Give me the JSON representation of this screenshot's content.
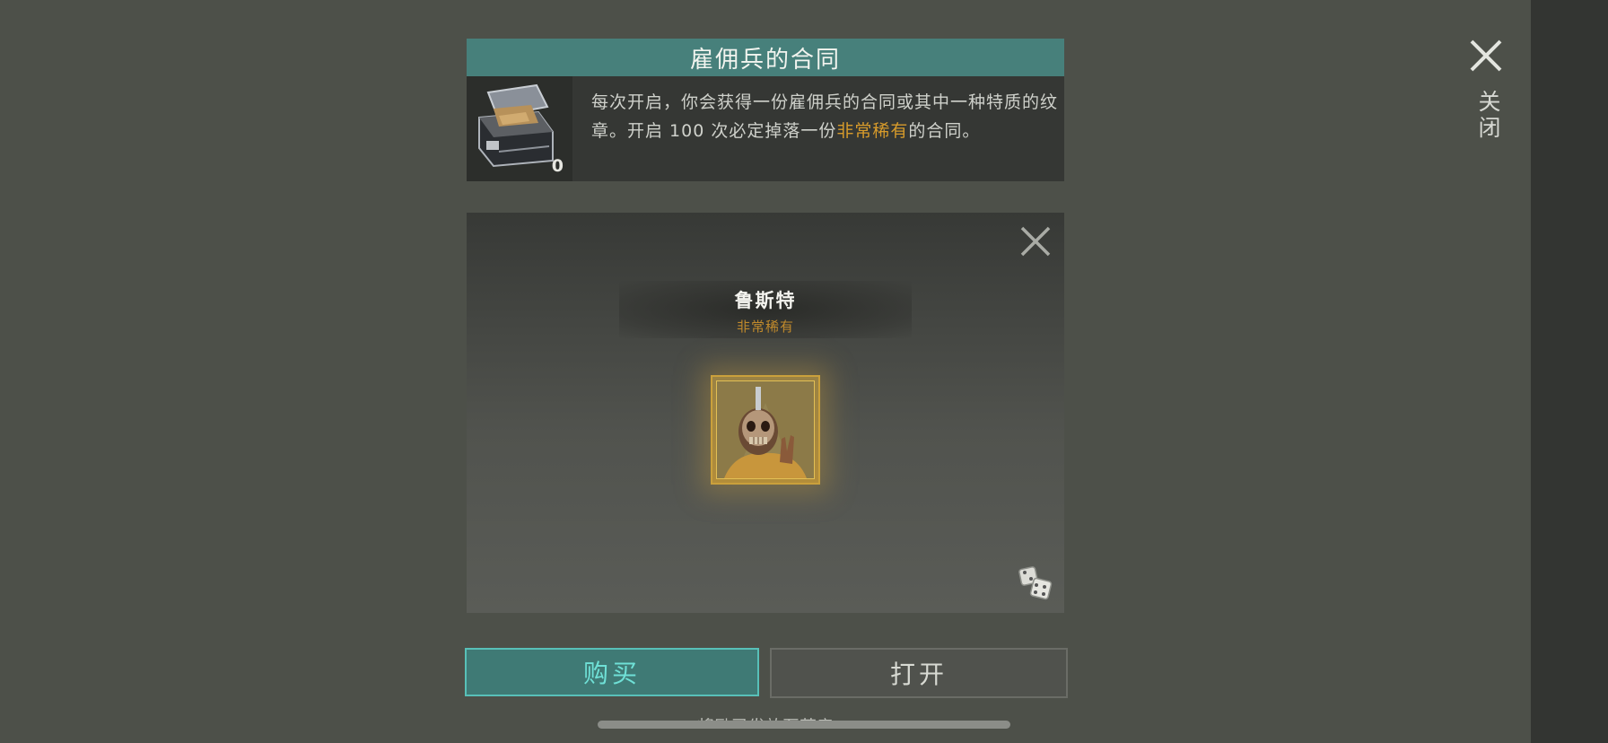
{
  "close": {
    "label": "关闭"
  },
  "info": {
    "title": "雇佣兵的合同",
    "chest_count": "0",
    "desc_part1": "每次开启，你会获得一份雇佣兵的合同或其中一种特质的纹章。开启 100 次必定掉落一份",
    "desc_rare": "非常稀有",
    "desc_part2": "的合同。"
  },
  "reward": {
    "name": "鲁斯特",
    "rarity": "非常稀有"
  },
  "buttons": {
    "buy": "购买",
    "open": "打开"
  },
  "bottom_note": "将励已发放至营房",
  "colors": {
    "accent_teal": "#47807b",
    "rare_gold": "#d79b2b"
  }
}
